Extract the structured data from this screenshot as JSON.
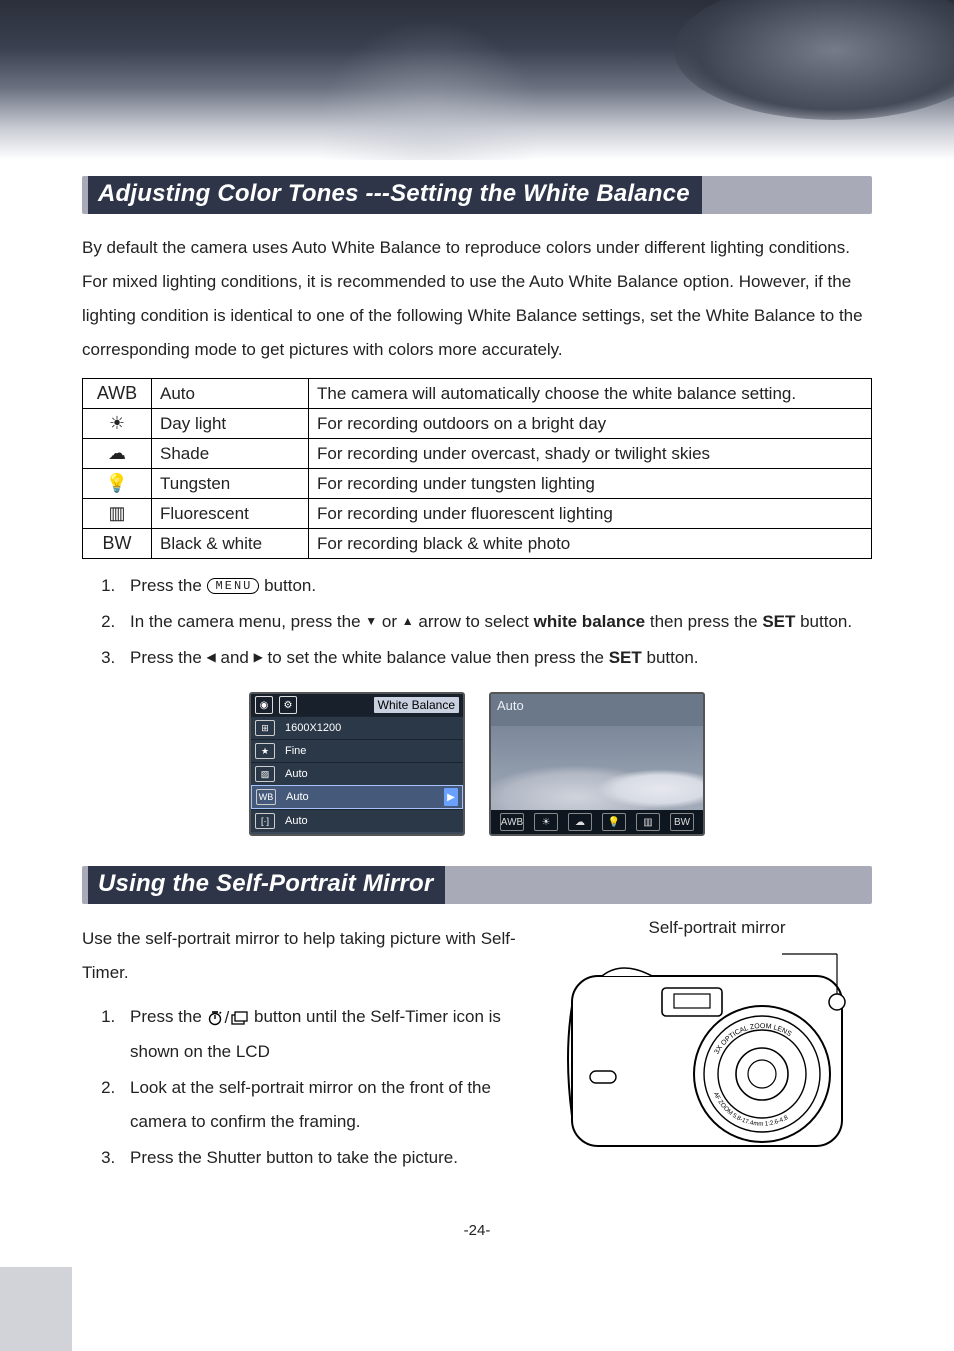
{
  "section1": {
    "title": "Adjusting Color Tones ---Setting the White Balance",
    "intro": "By default the camera uses Auto White Balance to reproduce colors under different lighting conditions. For mixed lighting conditions, it is recommended to use the Auto White Balance option. However, if the lighting condition is identical to one of the following White Balance settings, set the White Balance to the corresponding mode to get pictures with colors more accurately.",
    "table": [
      {
        "icon": "AWB",
        "name": "Auto",
        "desc": "The camera will automatically choose the white balance setting."
      },
      {
        "icon": "☀",
        "name": "Day light",
        "desc": "For recording outdoors on a bright day"
      },
      {
        "icon": "☁",
        "name": "Shade",
        "desc": "For recording under overcast, shady or twilight skies"
      },
      {
        "icon": "💡",
        "name": "Tungsten",
        "desc": "For recording under tungsten lighting"
      },
      {
        "icon": "▥",
        "name": "Fluorescent",
        "desc": "For recording under fluorescent lighting"
      },
      {
        "icon": "BW",
        "name": "Black & white",
        "desc": "For recording black & white photo"
      }
    ],
    "steps": {
      "s1a": "Press the ",
      "s1_menu": "MENU",
      "s1b": " button.",
      "s2a": "In the camera menu, press the ",
      "s2b": " or ",
      "s2c": " arrow to select ",
      "s2d": "white balance",
      "s2e": " then press the ",
      "s2f": "SET",
      "s2g": " button.",
      "s3a": "Press the ",
      "s3b": " and ",
      "s3c": " to set the white balance value then press the ",
      "s3d": "SET",
      "s3e": " button."
    },
    "lcd": {
      "title": "White Balance",
      "rows": [
        {
          "icon": "⊞",
          "value": "1600X1200"
        },
        {
          "icon": "★",
          "value": "Fine"
        },
        {
          "icon": "▨",
          "value": "Auto"
        },
        {
          "icon": "WB",
          "value": "Auto"
        },
        {
          "icon": "[·]",
          "value": "Auto"
        }
      ],
      "selected_index": 3,
      "preview_label": "Auto",
      "strip_icons": [
        "AWB",
        "☀",
        "☁",
        "💡",
        "▥",
        "BW"
      ]
    }
  },
  "section2": {
    "title": "Using the Self-Portrait Mirror",
    "intro": "Use the self-portrait mirror to help taking picture with Self-Timer.",
    "diagram_caption": "Self-portrait mirror",
    "lens_text1": "3X OPTICAL ZOOM LENS",
    "lens_text2": "AF ZOOM 5.8-17.4mm 1:2.6-4.8",
    "steps": {
      "s1a": "Press the ",
      "s1b": " button until the Self-Timer icon is shown on the LCD",
      "s2": "Look at the self-portrait mirror on the front of the camera to confirm the framing.",
      "s3": "Press the Shutter button to take the picture."
    }
  },
  "page_number": "-24-"
}
